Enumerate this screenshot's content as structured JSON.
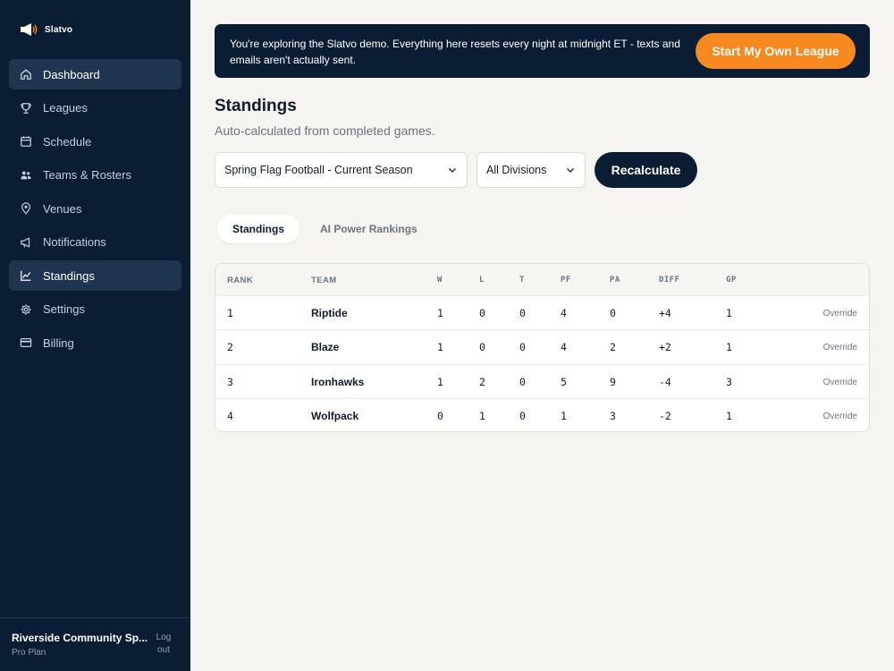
{
  "brand": {
    "name": "Slatvo"
  },
  "sidebar": {
    "items": [
      {
        "label": "Dashboard",
        "icon": "home-icon",
        "active": true
      },
      {
        "label": "Leagues",
        "icon": "trophy-icon",
        "active": false
      },
      {
        "label": "Schedule",
        "icon": "calendar-icon",
        "active": false
      },
      {
        "label": "Teams & Rosters",
        "icon": "users-icon",
        "active": false
      },
      {
        "label": "Venues",
        "icon": "map-pin-icon",
        "active": false
      },
      {
        "label": "Notifications",
        "icon": "megaphone-icon",
        "active": false
      },
      {
        "label": "Standings",
        "icon": "chart-line-icon",
        "active": true
      },
      {
        "label": "Settings",
        "icon": "gear-icon",
        "active": false
      },
      {
        "label": "Billing",
        "icon": "credit-card-icon",
        "active": false
      }
    ],
    "footer": {
      "org_name": "Riverside Community Sp...",
      "plan": "Pro Plan",
      "logout": "Log out"
    }
  },
  "banner": {
    "text": "You're exploring the Slatvo demo. Everything here resets every night at midnight ET - texts and emails aren't actually sent.",
    "button": "Start My Own League"
  },
  "page": {
    "title": "Standings",
    "subtitle": "Auto-calculated from completed games."
  },
  "filters": {
    "season": "Spring Flag Football - Current Season",
    "division": "All Divisions",
    "recalculate": "Recalculate"
  },
  "tabs": [
    {
      "label": "Standings",
      "active": true
    },
    {
      "label": "AI Power Rankings",
      "active": false
    }
  ],
  "table": {
    "headers": {
      "rank": "RANK",
      "team": "TEAM",
      "w": "W",
      "l": "L",
      "t": "T",
      "pf": "PF",
      "pa": "PA",
      "diff": "DIFF",
      "gp": "GP"
    },
    "override_label": "Override",
    "rows": [
      {
        "rank": "1",
        "team": "Riptide",
        "w": "1",
        "l": "0",
        "t": "0",
        "pf": "4",
        "pa": "0",
        "diff": "+4",
        "gp": "1"
      },
      {
        "rank": "2",
        "team": "Blaze",
        "w": "1",
        "l": "0",
        "t": "0",
        "pf": "4",
        "pa": "2",
        "diff": "+2",
        "gp": "1"
      },
      {
        "rank": "3",
        "team": "Ironhawks",
        "w": "1",
        "l": "2",
        "t": "0",
        "pf": "5",
        "pa": "9",
        "diff": "-4",
        "gp": "3"
      },
      {
        "rank": "4",
        "team": "Wolfpack",
        "w": "0",
        "l": "1",
        "t": "0",
        "pf": "1",
        "pa": "3",
        "diff": "-2",
        "gp": "1"
      }
    ]
  },
  "colors": {
    "navy": "#0b1d33",
    "accent": "#f6891f",
    "background": "#f5f4f0"
  }
}
